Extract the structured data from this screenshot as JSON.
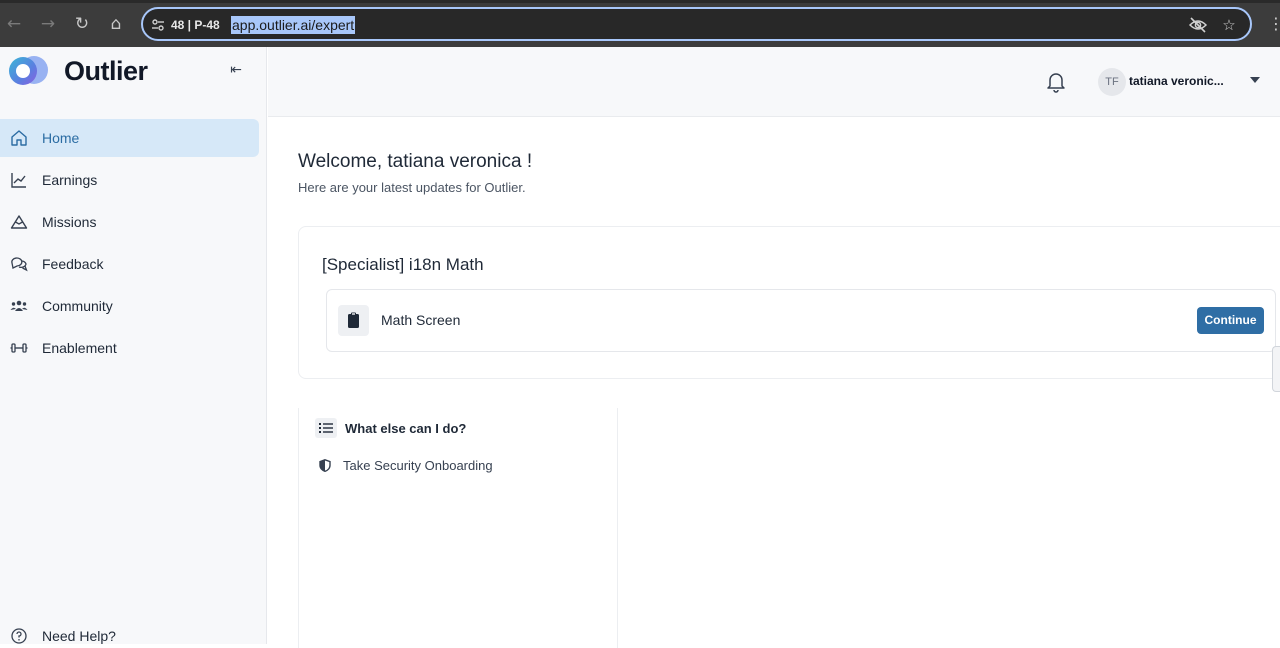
{
  "browser": {
    "tab_chip": "48 | P-48",
    "url": "app.outlier.ai/expert"
  },
  "sidebar": {
    "logo_text": "Outlier",
    "items": [
      {
        "label": "Home",
        "icon": "home-icon",
        "active": true
      },
      {
        "label": "Earnings",
        "icon": "chart-line-icon",
        "active": false
      },
      {
        "label": "Missions",
        "icon": "mountain-icon",
        "active": false
      },
      {
        "label": "Feedback",
        "icon": "chat-bubbles-icon",
        "active": false
      },
      {
        "label": "Community",
        "icon": "people-icon",
        "active": false
      },
      {
        "label": "Enablement",
        "icon": "dumbbell-icon",
        "active": false
      }
    ],
    "help_label": "Need Help?"
  },
  "header": {
    "avatar_initials": "TF",
    "user_name": "tatiana veronic..."
  },
  "main": {
    "welcome": "Welcome, tatiana veronica !",
    "subtitle": "Here are your latest updates for Outlier.",
    "project": {
      "title": "[Specialist] i18n Math",
      "task_name": "Math Screen",
      "action_label": "Continue"
    },
    "todo": {
      "heading": "What else can I do?",
      "items": [
        "Take Security Onboarding"
      ]
    }
  },
  "colors": {
    "accent": "#2f6ea5",
    "active_nav_bg": "#d6e8f8",
    "sidebar_bg": "#f7f8fa"
  }
}
